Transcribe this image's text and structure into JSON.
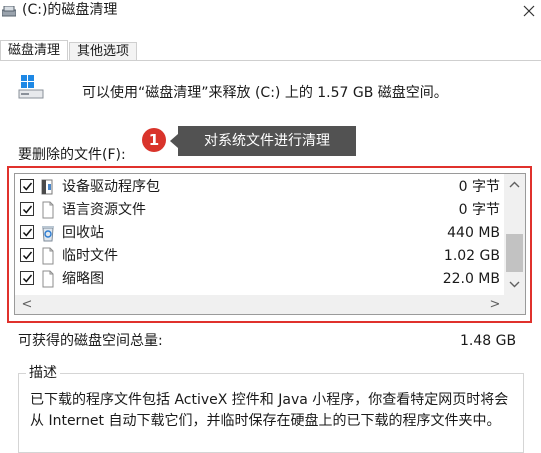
{
  "window": {
    "title": "(C:)的磁盘清理",
    "close_symbol": "✕",
    "icon": "disk-cleanup-icon"
  },
  "tabs": [
    {
      "label": "磁盘清理",
      "active": true
    },
    {
      "label": "其他选项",
      "active": false
    }
  ],
  "info": {
    "text": "可以使用“磁盘清理”来释放 (C:) 上的 1.57 GB 磁盘空间。",
    "icon": "hard-drive-icon"
  },
  "annotation": {
    "badge": "1",
    "tooltip": "对系统文件进行清理",
    "badge_color": "#d9342b",
    "tooltip_color": "#525252",
    "highlight_color": "#e0312c"
  },
  "files": {
    "label": "要删除的文件(F):",
    "items": [
      {
        "name": "设备驱动程序包",
        "size": "0 字节",
        "checked": true,
        "icon": "driver-package-icon"
      },
      {
        "name": "语言资源文件",
        "size": "0 字节",
        "checked": true,
        "icon": "blank-file-icon"
      },
      {
        "name": "回收站",
        "size": "440 MB",
        "checked": true,
        "icon": "recycle-bin-icon"
      },
      {
        "name": "临时文件",
        "size": "1.02 GB",
        "checked": true,
        "icon": "blank-file-icon"
      },
      {
        "name": "缩略图",
        "size": "22.0 MB",
        "checked": true,
        "icon": "blank-file-icon"
      }
    ],
    "scroll_up": "⌃",
    "scroll_down": "⌄",
    "scroll_left": "<",
    "scroll_right": ">"
  },
  "total": {
    "label": "可获得的磁盘空间总量:",
    "value": "1.48 GB"
  },
  "description": {
    "title": "描述",
    "text": "已下载的程序文件包括 ActiveX 控件和 Java 小程序，你查看特定网页时将会从 Internet 自动下载它们，并临时保存在硬盘上的已下载的程序文件夹中。"
  }
}
